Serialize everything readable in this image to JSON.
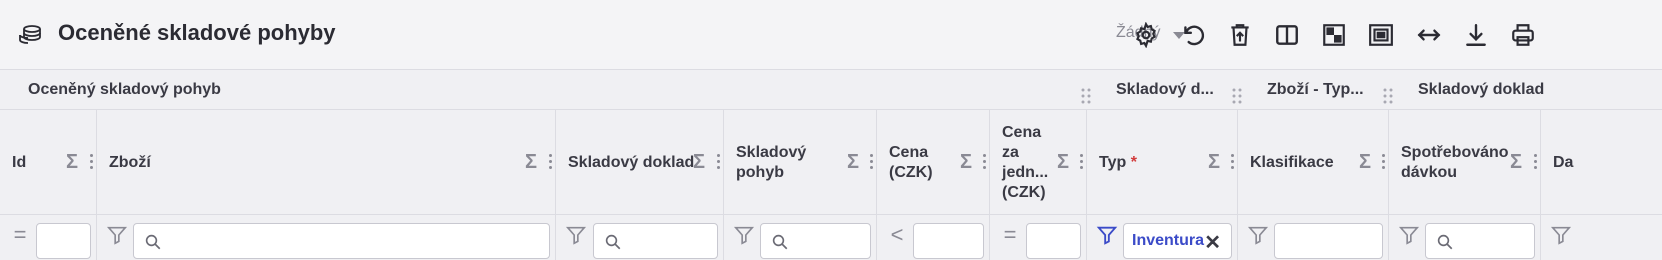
{
  "header": {
    "title": "Oceněné skladové pohyby",
    "title_icon": "database-icon",
    "preset_label": "Žádný",
    "toolbar_icons": [
      "gear-icon",
      "undo-icon",
      "delete-icon",
      "columns-icon",
      "checker-icon",
      "fit-icon",
      "arrows-horizontal-icon",
      "download-icon",
      "print-icon"
    ]
  },
  "groups": [
    {
      "label": "Oceněný skladový pohyb"
    },
    {
      "label": "Skladový d..."
    },
    {
      "label": "Zboží - Typ..."
    },
    {
      "label": "Skladový doklad"
    }
  ],
  "columns": [
    {
      "label": "Id",
      "filter_op": "="
    },
    {
      "label": "Zboží",
      "filter_op": "funnel"
    },
    {
      "label": "Skladový doklad",
      "filter_op": "funnel"
    },
    {
      "label": "Skladový pohyb",
      "filter_op": "funnel"
    },
    {
      "label": "Cena (CZK)",
      "filter_op": "<"
    },
    {
      "label": "Cena za jedn... (CZK)",
      "filter_op": "="
    },
    {
      "label": "Typ",
      "required": "*",
      "filter_op": "funnel-active",
      "filter_value": "Inventura"
    },
    {
      "label": "Klasifikace",
      "filter_op": "funnel"
    },
    {
      "label": "Spotřebováno dávkou",
      "filter_op": "funnel"
    },
    {
      "label": "Da",
      "filter_op": "funnel"
    }
  ],
  "colors": {
    "accent": "#3b4bc8",
    "required": "#d23b3b",
    "muted": "#8a8a94"
  }
}
